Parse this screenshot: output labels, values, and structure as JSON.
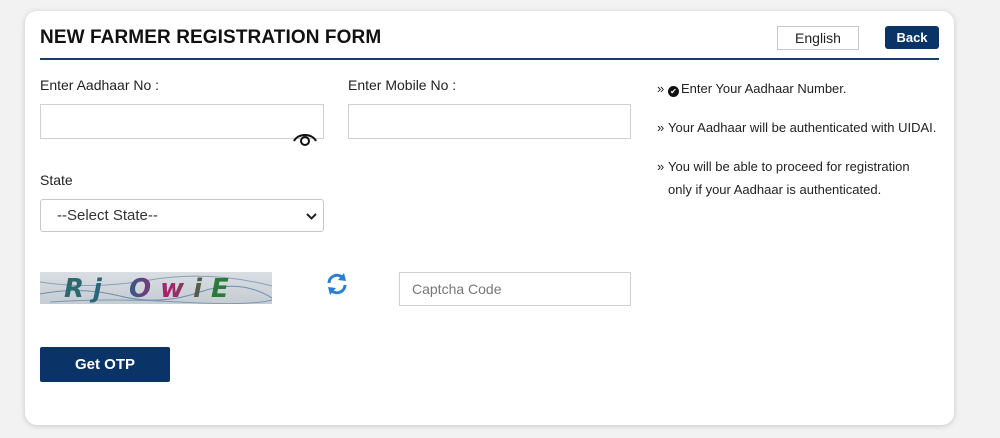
{
  "form": {
    "title": "NEW FARMER REGISTRATION FORM",
    "language": "English",
    "back_label": "Back",
    "aadhaar_label": "Enter Aadhaar No :",
    "aadhaar_value": "",
    "mobile_label": "Enter Mobile No :",
    "mobile_value": "",
    "state_label": "State",
    "state_selected": "--Select State--",
    "captcha_image_text": "Rj OwiE",
    "captcha_placeholder": "Captcha Code",
    "otp_label": "Get OTP"
  },
  "notes": [
    "Enter Your Aadhaar Number.",
    "Your Aadhaar will be authenticated with UIDAI.",
    "You will be able to proceed for registration only if your Aadhaar is authenticated."
  ],
  "icons": {
    "eye": "eye-icon",
    "refresh": "refresh-icon",
    "check": "check-circle-icon",
    "bullet": "double-chevron-icon"
  },
  "colors": {
    "primary": "#0a3468",
    "refresh": "#2a7fd4"
  }
}
